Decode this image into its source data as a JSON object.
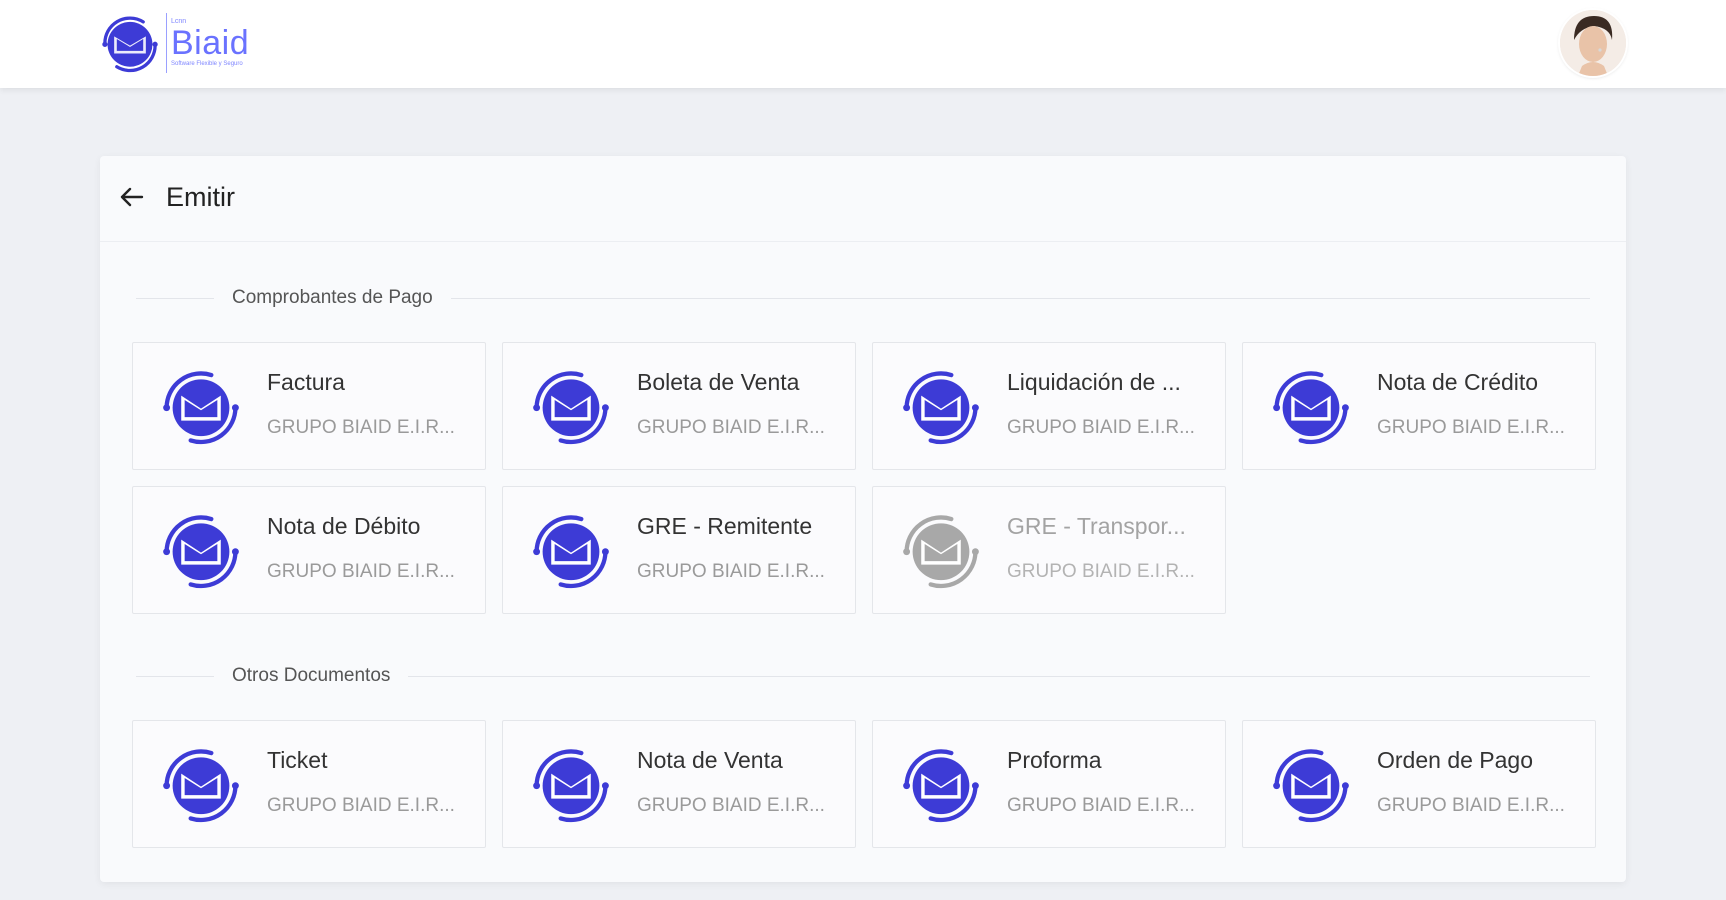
{
  "header": {
    "logo": {
      "small_text": "Lcnn",
      "brand": "Biaid",
      "tagline": "Software Flexible y Seguro"
    },
    "avatar_icon": "user-avatar"
  },
  "panel": {
    "title": "Emitir",
    "back_icon": "arrow-left-icon"
  },
  "sections": [
    {
      "label": "Comprobantes de Pago",
      "items": [
        {
          "title": "Factura",
          "subtitle": "GRUPO BIAID E.I.R...",
          "disabled": false
        },
        {
          "title": "Boleta de Venta",
          "subtitle": "GRUPO BIAID E.I.R...",
          "disabled": false
        },
        {
          "title": "Liquidación de ...",
          "subtitle": "GRUPO BIAID E.I.R...",
          "disabled": false
        },
        {
          "title": "Nota de Crédito",
          "subtitle": "GRUPO BIAID E.I.R...",
          "disabled": false
        },
        {
          "title": "Nota de Débito",
          "subtitle": "GRUPO BIAID E.I.R...",
          "disabled": false
        },
        {
          "title": "GRE - Remitente",
          "subtitle": "GRUPO BIAID E.I.R...",
          "disabled": false
        },
        {
          "title": "GRE - Transpor...",
          "subtitle": "GRUPO BIAID E.I.R...",
          "disabled": true
        }
      ]
    },
    {
      "label": "Otros Documentos",
      "items": [
        {
          "title": "Ticket",
          "subtitle": "GRUPO BIAID E.I.R...",
          "disabled": false
        },
        {
          "title": "Nota de Venta",
          "subtitle": "GRUPO BIAID E.I.R...",
          "disabled": false
        },
        {
          "title": "Proforma",
          "subtitle": "GRUPO BIAID E.I.R...",
          "disabled": false
        },
        {
          "title": "Orden de Pago",
          "subtitle": "GRUPO BIAID E.I.R...",
          "disabled": false
        }
      ]
    }
  ],
  "colors": {
    "brand": "#3d3bd6",
    "brand_light": "#6a72ff",
    "disabled_icon": "#a8a8a8",
    "page_bg": "#eef0f4"
  }
}
